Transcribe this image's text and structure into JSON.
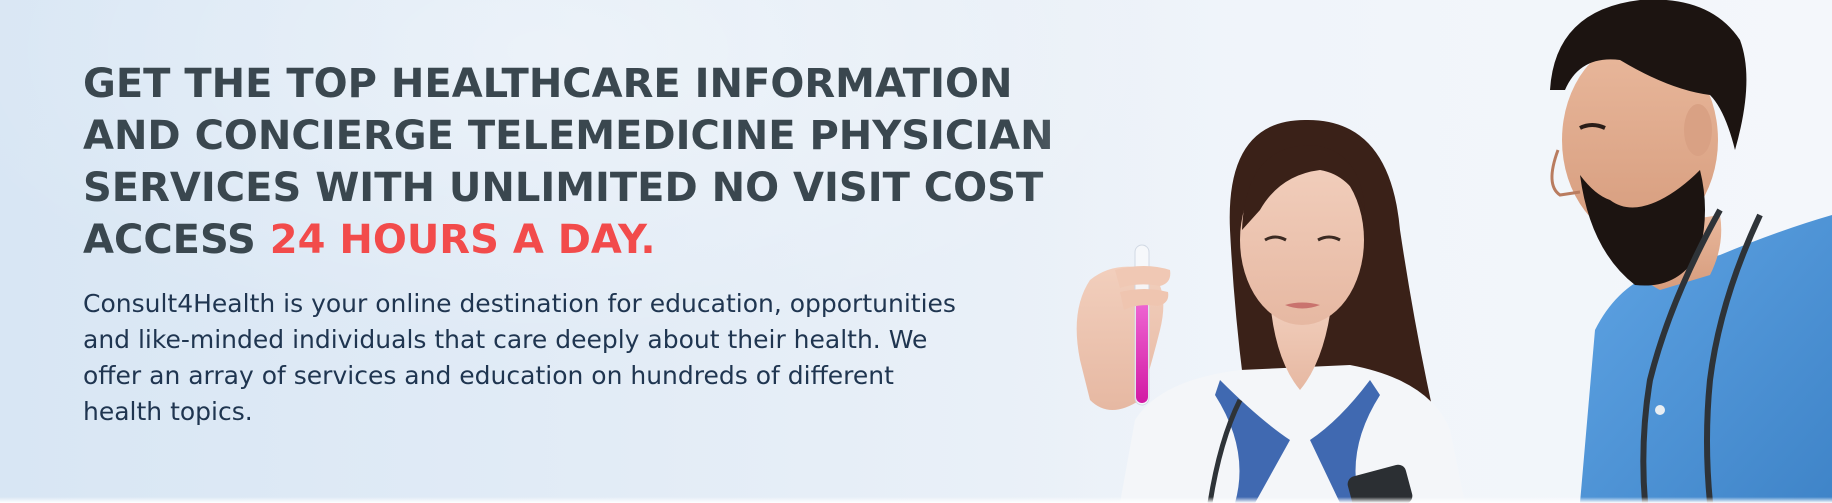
{
  "hero": {
    "headline": {
      "line1": "GET THE TOP HEALTHCARE INFORMATION",
      "line2": "AND CONCIERGE TELEMEDICINE PHYSICIAN",
      "line3": "SERVICES WITH UNLIMITED NO VISIT COST",
      "line4_prefix": "ACCESS ",
      "line4_accent": "24 HOURS A DAY."
    },
    "body": {
      "line1": "Consult4Health is your online destination for education, opportunities",
      "line2": "and like-minded individuals that care deeply about their health. We",
      "line3": "offer an array of services and education on hundreds of different",
      "line4": "health topics."
    },
    "colors": {
      "headline": "#3a474f",
      "accent": "#f24b4b",
      "body": "#1f3550",
      "scrubs": "#4a90d4"
    },
    "photo": {
      "subject": "two-doctors-with-test-tube"
    }
  }
}
